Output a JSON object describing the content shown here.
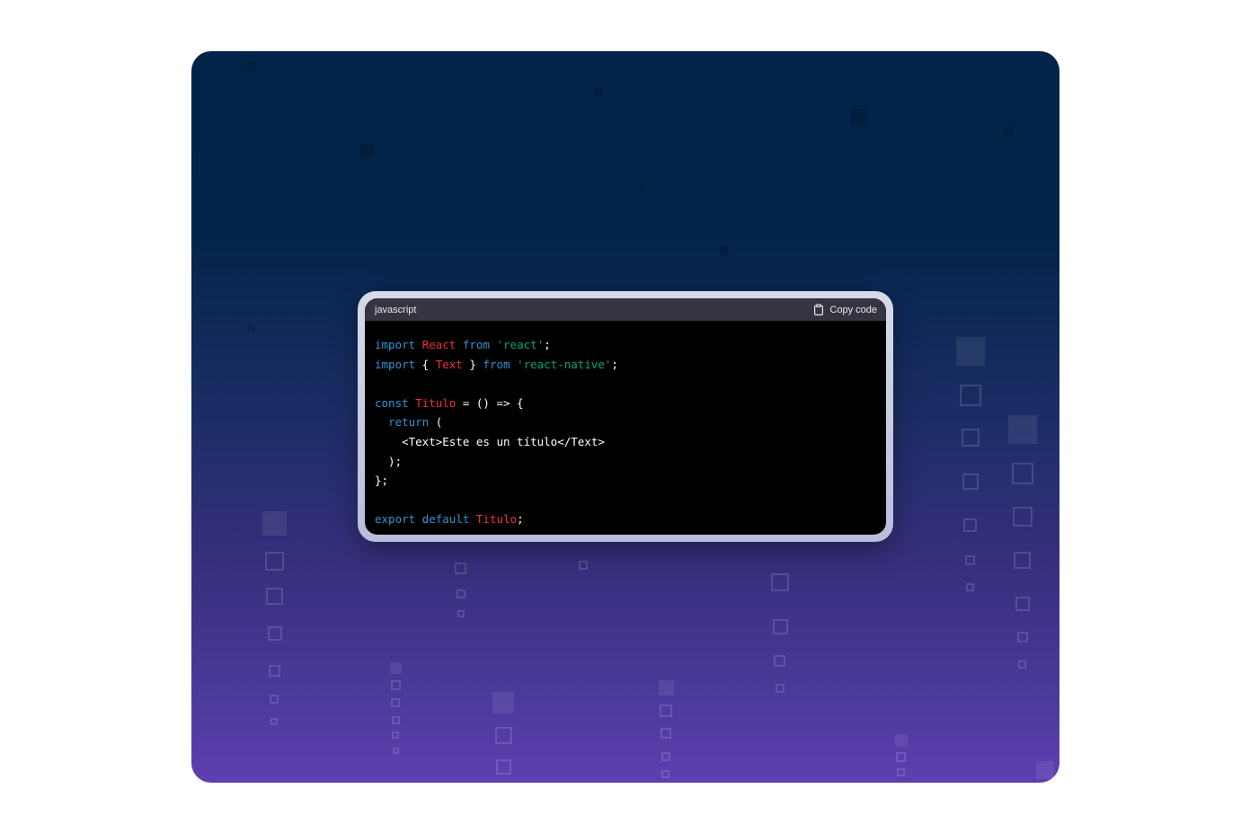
{
  "code_block": {
    "language": "javascript",
    "copy_label": "Copy code",
    "copy_icon": "clipboard-icon",
    "colors": {
      "keyword": "#2e95d3",
      "identifier": "#f22c3d",
      "string": "#00a67d",
      "plain": "#ffffff",
      "header_bg": "#343541",
      "code_bg": "#000000"
    },
    "lines": [
      [
        {
          "t": "import",
          "c": "kw"
        },
        {
          "t": " ",
          "c": "pl"
        },
        {
          "t": "React",
          "c": "id"
        },
        {
          "t": " ",
          "c": "pl"
        },
        {
          "t": "from",
          "c": "kw"
        },
        {
          "t": " ",
          "c": "pl"
        },
        {
          "t": "'react'",
          "c": "str"
        },
        {
          "t": ";",
          "c": "pl"
        }
      ],
      [
        {
          "t": "import",
          "c": "kw"
        },
        {
          "t": " { ",
          "c": "pl"
        },
        {
          "t": "Text",
          "c": "id"
        },
        {
          "t": " } ",
          "c": "pl"
        },
        {
          "t": "from",
          "c": "kw"
        },
        {
          "t": " ",
          "c": "pl"
        },
        {
          "t": "'react-native'",
          "c": "str"
        },
        {
          "t": ";",
          "c": "pl"
        }
      ],
      [],
      [
        {
          "t": "const",
          "c": "kw"
        },
        {
          "t": " ",
          "c": "pl"
        },
        {
          "t": "Titulo",
          "c": "id"
        },
        {
          "t": " = () => {",
          "c": "pl"
        }
      ],
      [
        {
          "t": "  ",
          "c": "pl"
        },
        {
          "t": "return",
          "c": "kw"
        },
        {
          "t": " (",
          "c": "pl"
        }
      ],
      [
        {
          "t": "    <Text>Este es un título</Text>",
          "c": "pl"
        }
      ],
      [
        {
          "t": "  );",
          "c": "pl"
        }
      ],
      [
        {
          "t": "};",
          "c": "pl"
        }
      ],
      [],
      [
        {
          "t": "export",
          "c": "kw"
        },
        {
          "t": " ",
          "c": "pl"
        },
        {
          "t": "default",
          "c": "kw"
        },
        {
          "t": " ",
          "c": "pl"
        },
        {
          "t": "Titulo",
          "c": "id"
        },
        {
          "t": ";",
          "c": "pl"
        }
      ]
    ]
  }
}
